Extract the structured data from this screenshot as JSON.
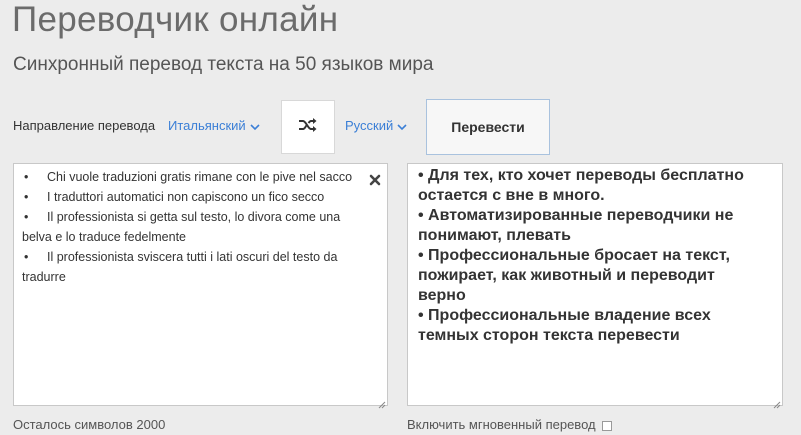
{
  "header": {
    "title": "Переводчик онлайн",
    "subtitle": "Синхронный перевод текста на 50 языков мира"
  },
  "controls": {
    "direction_label": "Направление перевода",
    "source_lang": "Итальянский",
    "target_lang": "Русский",
    "swap_icon": "shuffle-icon",
    "translate_label": "Перевести",
    "accent_color": "#3b7fd6"
  },
  "source": {
    "items": [
      {
        "bullet": "•",
        "first": "Chi vuole traduzioni gratis rimane con le pive nel sacco",
        "cont": ""
      },
      {
        "bullet": "•",
        "first": "I traduttori automatici non capiscono un fico secco",
        "cont": ""
      },
      {
        "bullet": "•",
        "first": "Il professionista si getta sul testo, lo divora come una",
        "cont": "belva e lo traduce fedelmente"
      },
      {
        "bullet": "•",
        "first": "Il professionista sviscera tutti i lati oscuri del testo da",
        "cont": "tradurre"
      }
    ],
    "chars_left": "Осталось символов 2000"
  },
  "target": {
    "lines": [
      "• Для тех, кто хочет переводы бесплатно",
      "остается с вне в много.",
      "• Автоматизированные переводчики не",
      "понимают, плевать",
      "• Профессиональные бросает на текст,",
      "пожирает, как животный и переводит",
      "верно",
      "• Профессиональные владение всех",
      "темных сторон текста перевести"
    ],
    "instant_label": "Включить мгновенный перевод"
  }
}
